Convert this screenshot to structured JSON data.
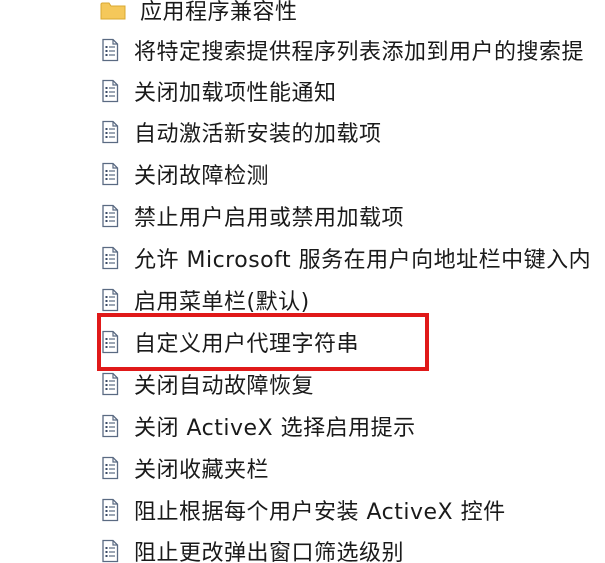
{
  "colors": {
    "highlight_border": "#e01919",
    "folder_fill": "#f5c85a",
    "icon_stroke": "#5a6a82",
    "text": "#1a1a1a"
  },
  "tree": {
    "items": [
      {
        "icon": "folder-icon",
        "label": "应用程序兼容性"
      },
      {
        "icon": "policy-setting-icon",
        "label": "将特定搜索提供程序列表添加到用户的搜索提"
      },
      {
        "icon": "policy-setting-icon",
        "label": "关闭加载项性能通知"
      },
      {
        "icon": "policy-setting-icon",
        "label": "自动激活新安装的加载项"
      },
      {
        "icon": "policy-setting-icon",
        "label": "关闭故障检测"
      },
      {
        "icon": "policy-setting-icon",
        "label": "禁止用户启用或禁用加载项"
      },
      {
        "icon": "policy-setting-icon",
        "label": "允许 Microsoft 服务在用户向地址栏中键入内"
      },
      {
        "icon": "policy-setting-icon",
        "label": "启用菜单栏(默认)"
      },
      {
        "icon": "policy-setting-icon",
        "label": "自定义用户代理字符串"
      },
      {
        "icon": "policy-setting-icon",
        "label": "关闭自动故障恢复"
      },
      {
        "icon": "policy-setting-icon",
        "label": "关闭 ActiveX 选择启用提示"
      },
      {
        "icon": "policy-setting-icon",
        "label": "关闭收藏夹栏"
      },
      {
        "icon": "policy-setting-icon",
        "label": "阻止根据每个用户安装 ActiveX 控件"
      },
      {
        "icon": "policy-setting-icon",
        "label": "阻止更改弹出窗口筛选级别"
      }
    ],
    "highlighted_item": "自定义用户代理字符串"
  }
}
